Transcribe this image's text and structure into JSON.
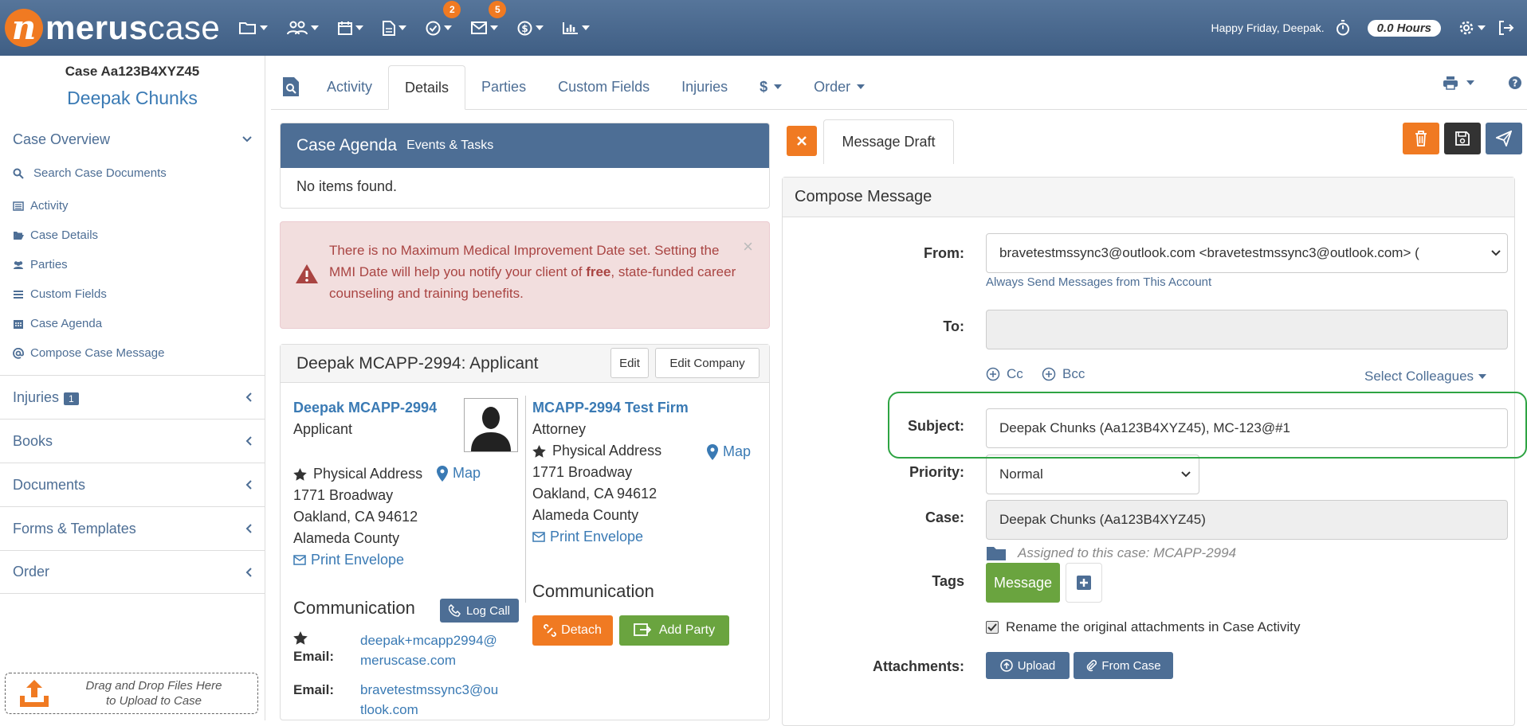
{
  "header": {
    "logo_text_bold": "merus",
    "logo_text": "case",
    "tasks_badge": "2",
    "mail_badge": "5",
    "greeting": "Happy Friday, Deepak.",
    "hours": "0.0 Hours"
  },
  "sidebar": {
    "case_number": "Case Aa123B4XYZ45",
    "case_name": "Deepak Chunks",
    "overview_label": "Case Overview",
    "sub_items": [
      {
        "label": "Search Case Documents",
        "icon": "search-icon"
      },
      {
        "label": "Activity",
        "icon": "list-icon"
      },
      {
        "label": "Case Details",
        "icon": "folder-open-icon"
      },
      {
        "label": "Parties",
        "icon": "users-icon"
      },
      {
        "label": "Custom Fields",
        "icon": "bars-icon"
      },
      {
        "label": "Case Agenda",
        "icon": "calendar-icon"
      },
      {
        "label": "Compose Case Message",
        "icon": "at-icon"
      }
    ],
    "sections": [
      {
        "label": "Injuries",
        "count": "1"
      },
      {
        "label": "Books"
      },
      {
        "label": "Documents"
      },
      {
        "label": "Forms & Templates"
      },
      {
        "label": "Order"
      }
    ],
    "dropzone_line1": "Drag and Drop Files Here",
    "dropzone_line2": "to Upload to Case"
  },
  "tabs": {
    "activity": "Activity",
    "details": "Details",
    "parties": "Parties",
    "custom_fields": "Custom Fields",
    "injuries": "Injuries",
    "money": "$",
    "order": "Order"
  },
  "agenda": {
    "title": "Case Agenda",
    "subtitle": "Events & Tasks",
    "empty": "No items found."
  },
  "alert": {
    "text_before": "There is no Maximum Medical Improvement Date set. Setting the MMI Date will help you notify your client of ",
    "text_bold": "free",
    "text_after": ", state-funded career counseling and training benefits.",
    "close": "×"
  },
  "party": {
    "title": "Deepak MCAPP-2994: Applicant",
    "edit": "Edit",
    "edit_company": "Edit Company",
    "applicant": {
      "name": "Deepak MCAPP-2994",
      "role": "Applicant",
      "address_label": "Physical Address",
      "map": "Map",
      "line1": "1771 Broadway",
      "line2": "Oakland, CA 94612",
      "line3": "Alameda County",
      "print": "Print Envelope"
    },
    "firm": {
      "name": "MCAPP-2994 Test Firm",
      "role": "Attorney",
      "address_label": "Physical Address",
      "map": "Map",
      "line1": "1771 Broadway",
      "line2": "Oakland, CA 94612",
      "line3": "Alameda County",
      "print": "Print Envelope"
    },
    "comm_left": "Communication",
    "log_call": "Log Call",
    "comm_right": "Communication",
    "detach": "Detach",
    "add_party": "Add Party",
    "email_label": "Email:",
    "email1_a": "deepak+mcapp2994@",
    "email1_b": "meruscase.com",
    "email2_a": "bravetestmssync3@ou",
    "email2_b": "tlook.com"
  },
  "message": {
    "tab_label": "Message Draft",
    "compose_title": "Compose Message",
    "from_label": "From:",
    "from_value": "bravetestmssync3@outlook.com <bravetestmssync3@outlook.com> (",
    "from_help": "Always Send Messages from This Account",
    "to_label": "To:",
    "cc": "Cc",
    "bcc": "Bcc",
    "select_colleagues": "Select Colleagues",
    "subject_label": "Subject:",
    "subject_value": "Deepak Chunks (Aa123B4XYZ45), MC-123@#1",
    "priority_label": "Priority:",
    "priority_value": "Normal",
    "case_label": "Case:",
    "case_value": "Deepak Chunks (Aa123B4XYZ45)",
    "assigned": "Assigned to this case: MCAPP-2994",
    "tags_label": "Tags",
    "tag_message": "Message",
    "rename_label": "Rename the original attachments in Case Activity",
    "attachments_label": "Attachments:",
    "upload": "Upload",
    "from_case": "From Case"
  },
  "colors": {
    "header": "#4d6e95",
    "accent_orange": "#f07a22",
    "green": "#6aa43f",
    "link": "#3a7ab4",
    "highlight": "#2ea443"
  }
}
